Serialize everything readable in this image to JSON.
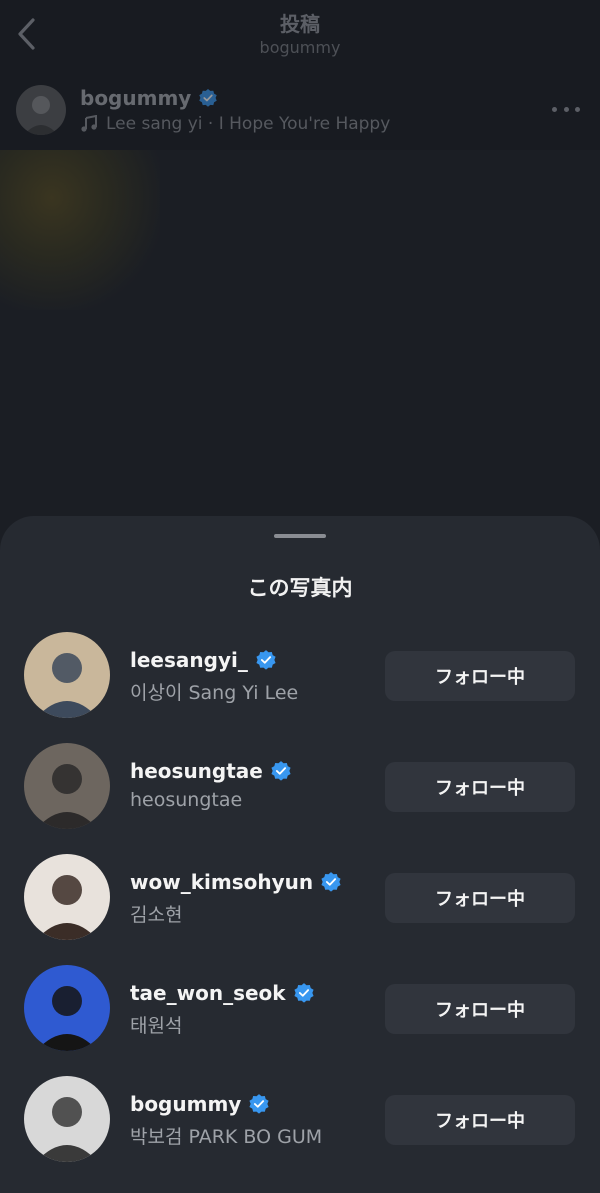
{
  "header": {
    "title": "投稿",
    "subtitle": "bogummy"
  },
  "post": {
    "username": "bogummy",
    "music": "Lee sang yi · I Hope You're Happy"
  },
  "sheet": {
    "title": "この写真内",
    "users": [
      {
        "username": "leesangyi_",
        "display_name": "이상이 Sang Yi Lee",
        "button": "フォロー中",
        "avatar_colors": [
          "#c9b79b",
          "#3d4a5c"
        ]
      },
      {
        "username": "heosungtae",
        "display_name": "heosungtae",
        "button": "フォロー中",
        "avatar_colors": [
          "#6d665f",
          "#2c2a2a"
        ]
      },
      {
        "username": "wow_kimsohyun",
        "display_name": "김소현",
        "button": "フォロー中",
        "avatar_colors": [
          "#e8e2dc",
          "#3b2d27"
        ]
      },
      {
        "username": "tae_won_seok",
        "display_name": "태원석",
        "button": "フォロー中",
        "avatar_colors": [
          "#2f5ad1",
          "#151515"
        ]
      },
      {
        "username": "bogummy",
        "display_name": "박보검 PARK BO GUM",
        "button": "フォロー中",
        "avatar_colors": [
          "#d8d8d8",
          "#3a3a3a"
        ]
      }
    ]
  },
  "colors": {
    "verified": "#3897f0",
    "sheet_bg": "#262a31",
    "button_bg": "#31353d"
  }
}
